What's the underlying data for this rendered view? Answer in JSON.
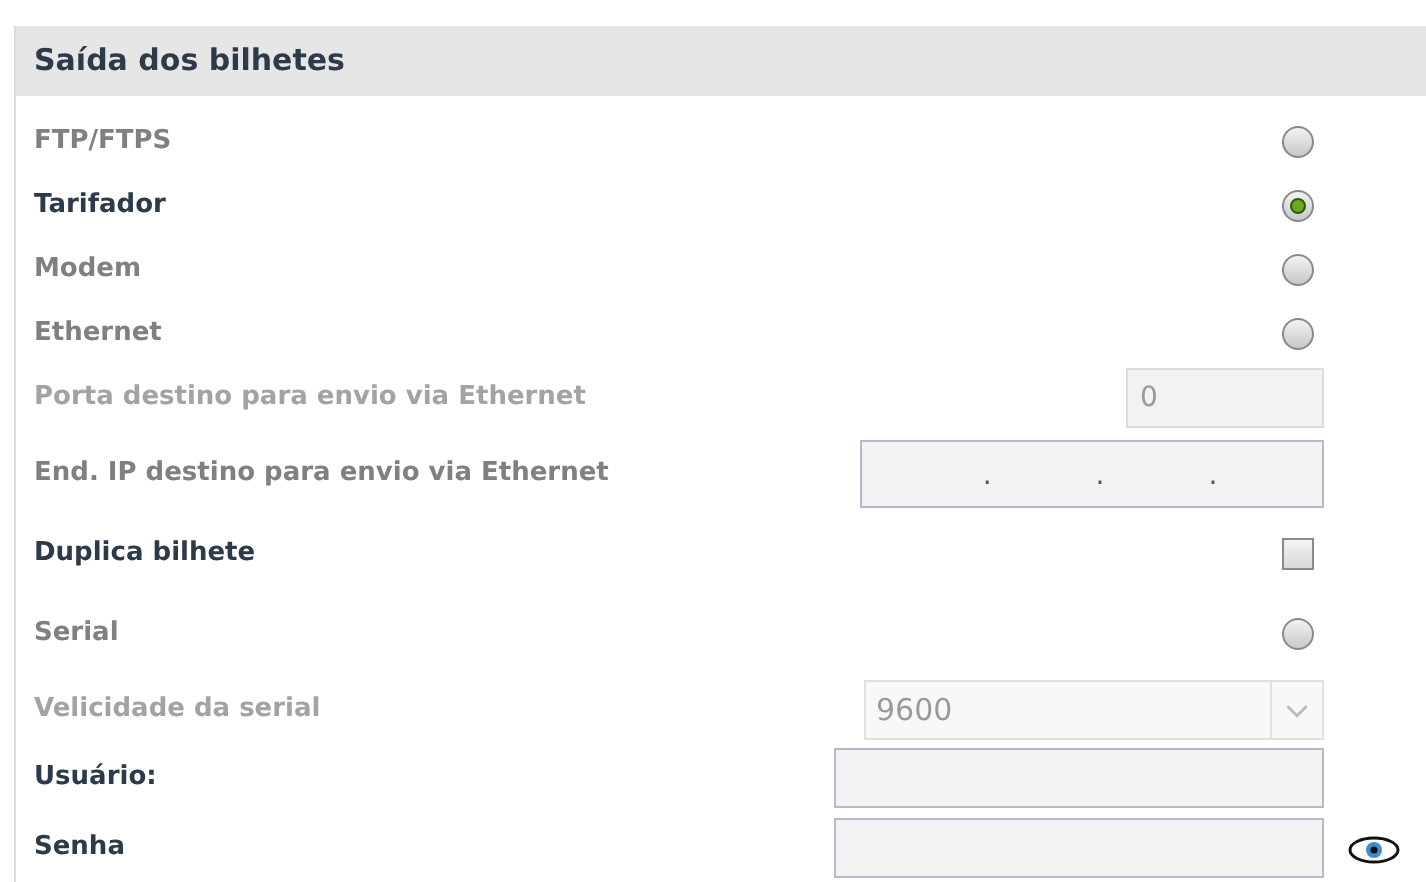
{
  "section": {
    "title": "Saída dos bilhetes"
  },
  "rows": [
    {
      "kind": "radio",
      "label": "FTP/FTPS",
      "emphasis": false,
      "disabled": false,
      "selected": false
    },
    {
      "kind": "radio",
      "label": "Tarifador",
      "emphasis": true,
      "disabled": false,
      "selected": true
    },
    {
      "kind": "radio",
      "label": "Modem",
      "emphasis": false,
      "disabled": false,
      "selected": false
    },
    {
      "kind": "radio",
      "label": "Ethernet",
      "emphasis": false,
      "disabled": false,
      "selected": false
    },
    {
      "kind": "port",
      "label": "Porta destino para envio via Ethernet",
      "disabled": true,
      "value": "0"
    },
    {
      "kind": "ip",
      "label": "End. IP destino para envio via Ethernet",
      "emphasis": false,
      "disabled": false,
      "dots": [
        ".",
        ".",
        "."
      ]
    },
    {
      "kind": "checkbox",
      "label": "Duplica bilhete",
      "emphasis": true,
      "disabled": false,
      "checked": false
    },
    {
      "kind": "radio",
      "label": "Serial",
      "emphasis": false,
      "disabled": false,
      "selected": false
    },
    {
      "kind": "select",
      "label": "Velicidade da serial",
      "disabled": true,
      "value": "9600"
    },
    {
      "kind": "input",
      "label": "Usuário:",
      "emphasis": true,
      "disabled": false
    },
    {
      "kind": "password",
      "label": "Senha",
      "emphasis": true,
      "disabled": false
    }
  ]
}
